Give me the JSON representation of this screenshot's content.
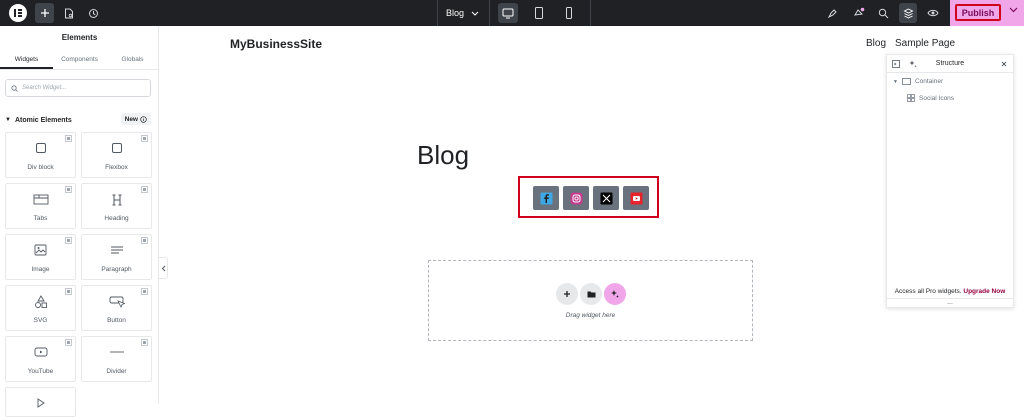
{
  "topbar": {
    "page_name": "Blog",
    "publish_label": "Publish",
    "icons": [
      "elementor-logo-icon",
      "add-icon",
      "page-settings-icon",
      "history-icon",
      "desktop-icon",
      "tablet-icon",
      "mobile-icon",
      "site-settings-icon",
      "notifications-icon",
      "search-icon",
      "structure-icon",
      "preview-icon"
    ]
  },
  "panel": {
    "title": "Elements",
    "tabs": [
      "Widgets",
      "Components",
      "Globals"
    ],
    "search_placeholder": "Search Widget...",
    "section_title": "Atomic Elements",
    "new_badge": "New",
    "widgets": [
      {
        "label": "Div block",
        "icon": "div-block-icon"
      },
      {
        "label": "Flexbox",
        "icon": "flexbox-icon"
      },
      {
        "label": "Tabs",
        "icon": "tabs-icon"
      },
      {
        "label": "Heading",
        "icon": "heading-icon"
      },
      {
        "label": "Image",
        "icon": "image-icon"
      },
      {
        "label": "Paragraph",
        "icon": "paragraph-icon"
      },
      {
        "label": "SVG",
        "icon": "svg-icon"
      },
      {
        "label": "Button",
        "icon": "button-icon"
      },
      {
        "label": "YouTube",
        "icon": "youtube-icon"
      },
      {
        "label": "Divider",
        "icon": "divider-icon"
      }
    ]
  },
  "canvas": {
    "site_title": "MyBusinessSite",
    "nav": [
      "Blog",
      "Sample Page"
    ],
    "heading": "Blog",
    "social_icons": [
      "facebook-icon",
      "instagram-icon",
      "x-icon",
      "youtube-icon"
    ],
    "drop_text": "Drag widget here"
  },
  "structure": {
    "title": "Structure",
    "items": [
      "Container",
      "Social Icons"
    ],
    "footer_text": "Access all Pro widgets.",
    "footer_link": "Upgrade Now",
    "more": "..."
  },
  "colors": {
    "topbar_bg": "#1f2124",
    "publish_bg": "#f0a6e8",
    "highlight_border": "#d0021b",
    "upgrade_link": "#93003f"
  }
}
